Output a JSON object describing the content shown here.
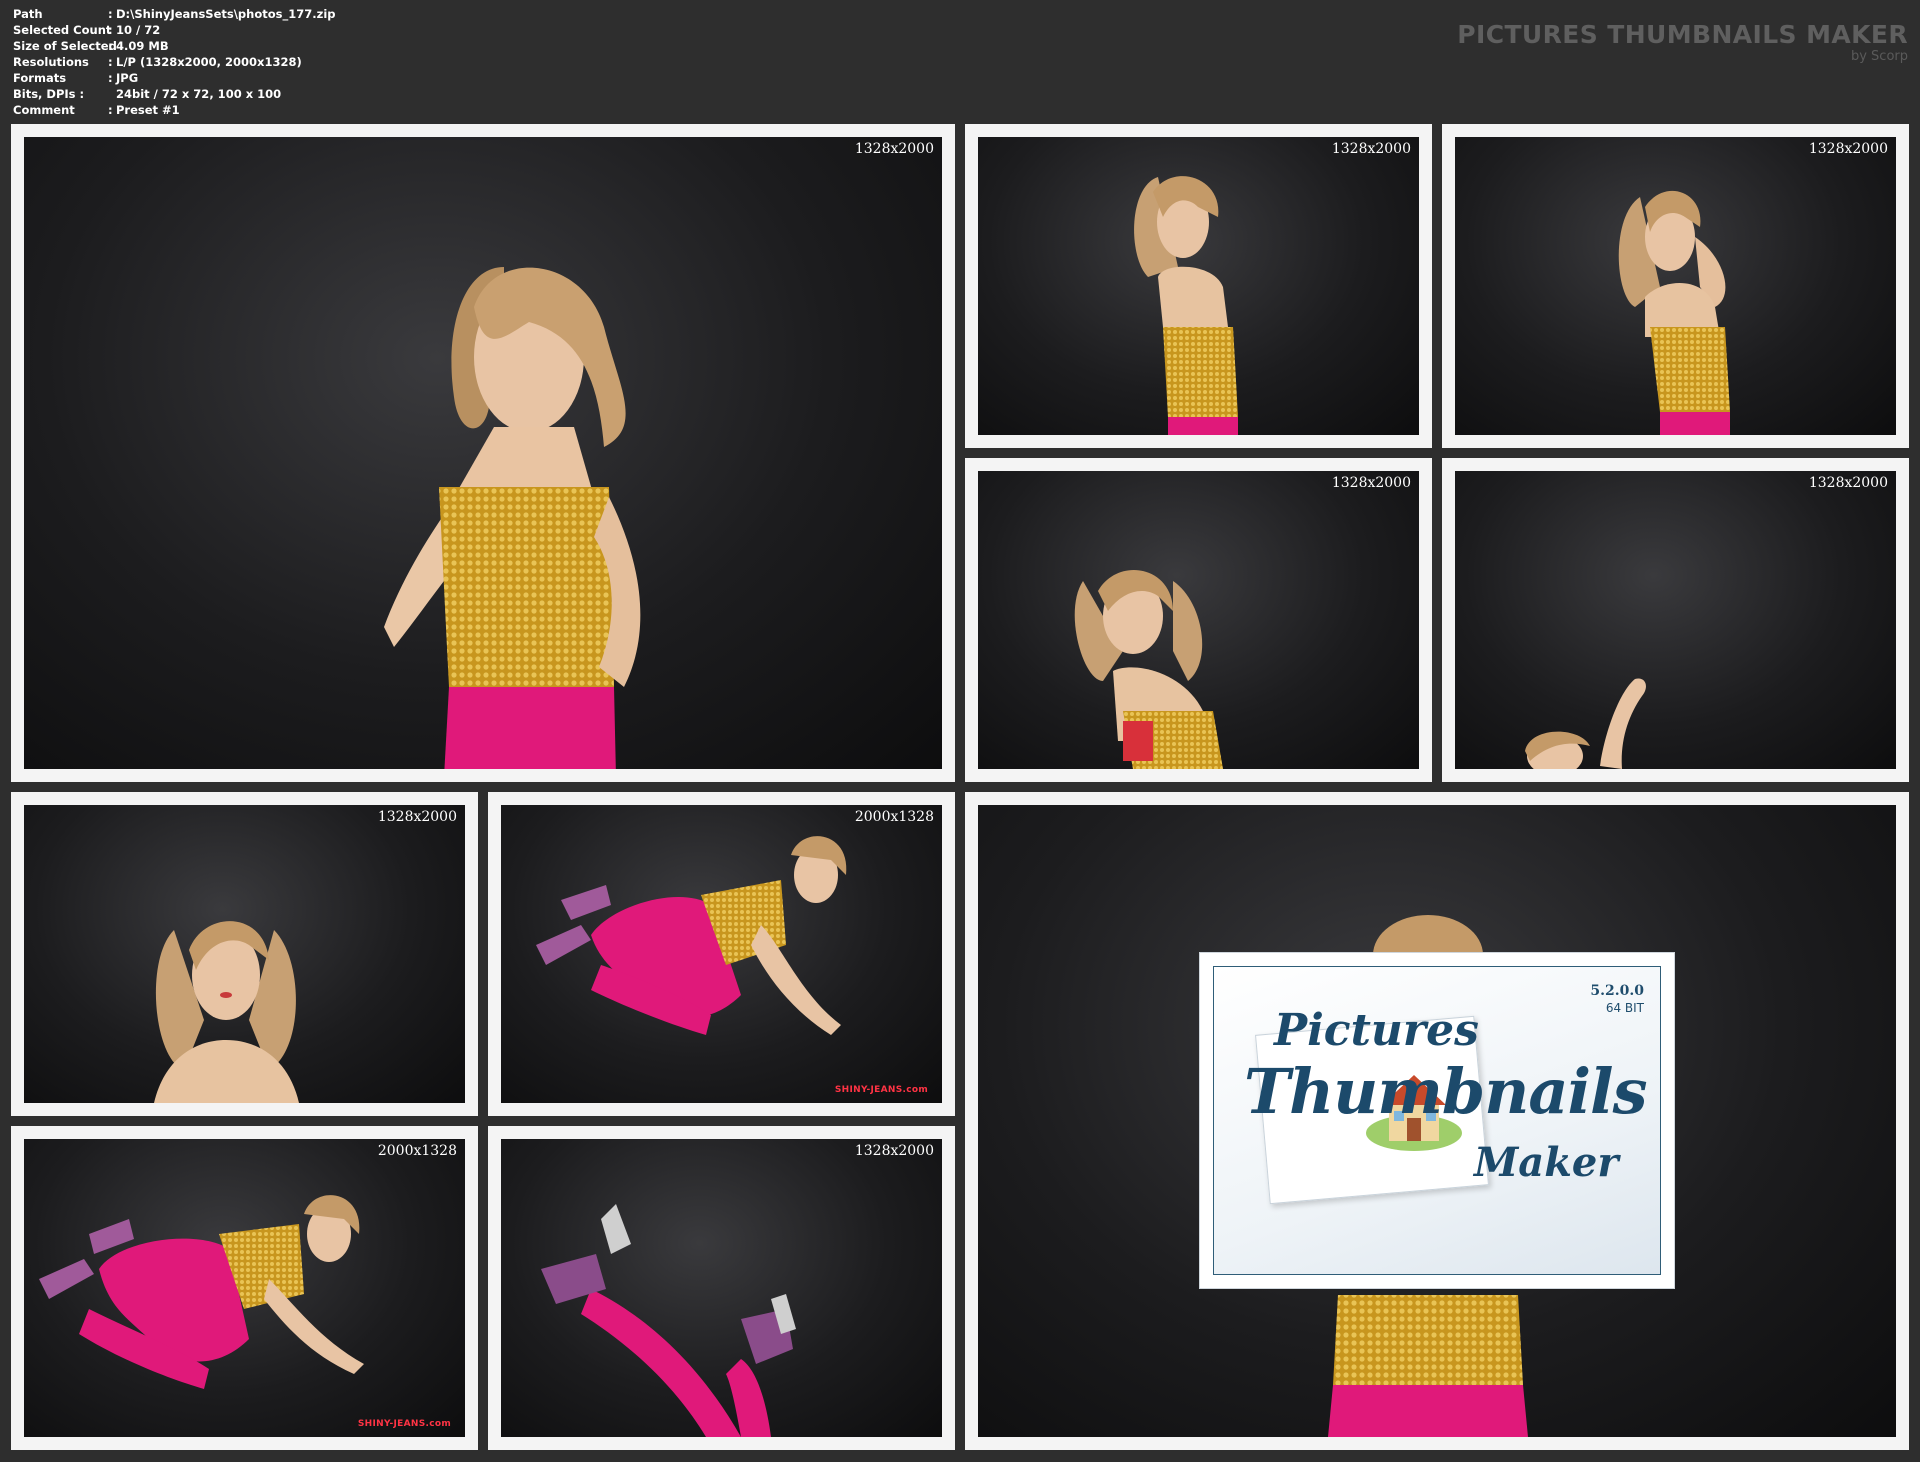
{
  "header": {
    "info": [
      {
        "key": "Path",
        "value": "D:\\ShinyJeansSets\\photos_177.zip"
      },
      {
        "key": "Selected Count",
        "value": "10 / 72"
      },
      {
        "key": "Size of Selected",
        "value": "4.09 MB"
      },
      {
        "key": "Resolutions",
        "value": "L/P (1328x2000, 2000x1328)"
      },
      {
        "key": "Formats",
        "value": "JPG"
      },
      {
        "key": "Bits, DPIs :",
        "value": "24bit / 72 x 72, 100 x 100"
      },
      {
        "key": "Comment",
        "value": "Preset #1"
      }
    ],
    "separator": ":",
    "brand_title": "PICTURES THUMBNAILS MAKER",
    "brand_sub": "by Scorp"
  },
  "thumbnails": [
    {
      "res": "1328x2000"
    },
    {
      "res": "1328x2000"
    },
    {
      "res": "1328x2000"
    },
    {
      "res": "1328x2000"
    },
    {
      "res": "1328x2000"
    },
    {
      "res": "1328x2000"
    },
    {
      "res": "2000x1328",
      "watermark": "SHINY-JEANS.com"
    },
    {
      "res": "2000x1328",
      "watermark": "SHINY-JEANS.com"
    },
    {
      "res": "1328x2000"
    }
  ],
  "logo": {
    "version": "5.2.0.0",
    "bits": "64 BIT",
    "word1": "Pictures",
    "word2": "Thumbnails",
    "word3": "Maker"
  },
  "colors": {
    "background": "#2e2e2e",
    "frame": "#f4f4f4",
    "brand": "#5f5f5f",
    "logo_ink": "#1c4a6b",
    "top_gold": "#c8961e",
    "pants_pink": "#e0197a"
  }
}
